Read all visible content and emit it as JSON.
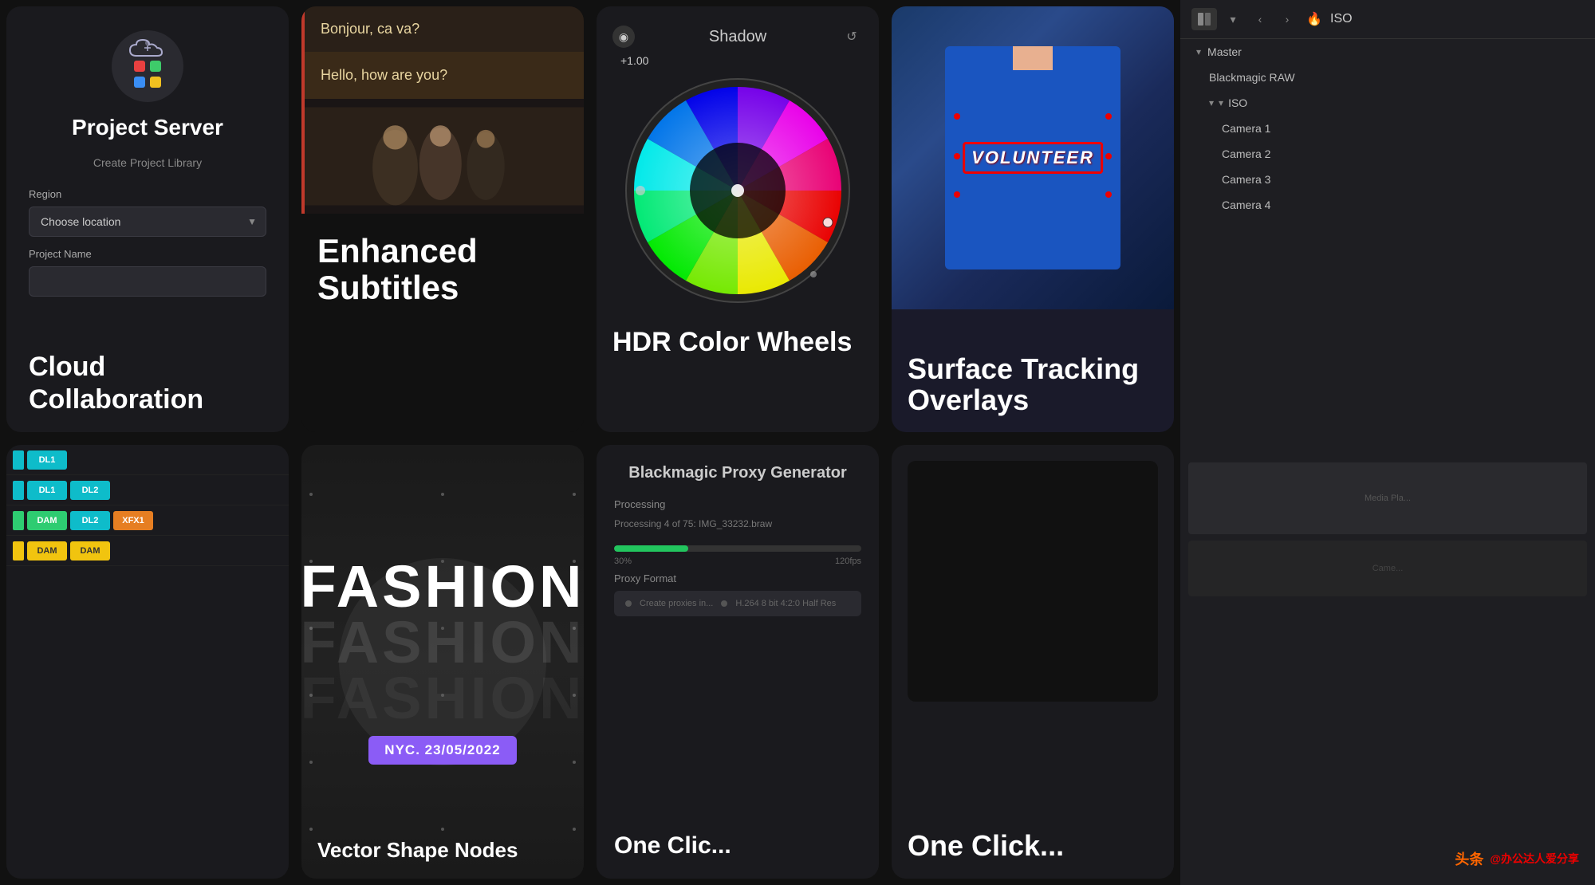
{
  "panels": {
    "projectServer": {
      "title": "Project Server",
      "createLabel": "Create Project Library",
      "regionLabel": "Region",
      "locationPlaceholder": "Choose location",
      "projectNameLabel": "Project Name",
      "cloudCollabTitle": "Cloud Collaboration"
    },
    "enhancedSubtitles": {
      "subtitle1": "Bonjour, ca va?",
      "subtitle2": "Hello, how are you?",
      "title": "Enhanced Subtitles"
    },
    "hdrColorWheels": {
      "shadowLabel": "Shadow",
      "value": "+1.00",
      "title": "HDR Color Wheels"
    },
    "surfaceTracking": {
      "volunteerText": "VOLUNTEER",
      "title": "Surface Tracking Overlays"
    },
    "isoPanel": {
      "label": "ISO",
      "tree": [
        {
          "label": "Master",
          "level": 0,
          "expandable": true
        },
        {
          "label": "Blackmagic RAW",
          "level": 1
        },
        {
          "label": "ISO",
          "level": 1,
          "expandable": true
        },
        {
          "label": "Camera 1",
          "level": 2
        },
        {
          "label": "Camera 2",
          "level": 2
        },
        {
          "label": "Camera 3",
          "level": 2
        },
        {
          "label": "Camera 4",
          "level": 2
        }
      ],
      "mediaPlaceholder": "Media Pla...",
      "cameraPlaceholder": "Came..."
    },
    "timeline": {
      "tracks": [
        {
          "indicator": "cyan",
          "blocks": [
            {
              "label": "DL1",
              "color": "cyan"
            },
            {
              "label": "DL1",
              "color": "cyan"
            },
            {
              "label": "DL2",
              "color": "cyan"
            }
          ]
        },
        {
          "indicator": "green",
          "blocks": [
            {
              "label": "DAM",
              "color": "green"
            },
            {
              "label": "DL2",
              "color": "cyan"
            },
            {
              "label": "XFX1",
              "color": "orange"
            }
          ]
        },
        {
          "indicator": "yellow",
          "blocks": [
            {
              "label": "DAM",
              "color": "yellow"
            },
            {
              "label": "DAM",
              "color": "yellow"
            }
          ]
        }
      ]
    },
    "vectorShape": {
      "fashionText": "FASHION",
      "fashionShadow": "FASHION",
      "date": "NYC. 23/05/2022",
      "title": "Vector Shape Nodes"
    },
    "proxyGenerator": {
      "title": "Blackmagic Proxy Generator",
      "processingLabel": "Processing",
      "fileText": "Processing 4 of 75: IMG_33232.braw",
      "progressPercent": "30%",
      "fps": "120fps",
      "proxyFormatLabel": "Proxy Format",
      "createProxyText": "Create proxies in...",
      "bigTitle": "One Clic..."
    }
  },
  "watermark": {
    "platform": "头条",
    "handle": "@办公达人爱分享"
  }
}
